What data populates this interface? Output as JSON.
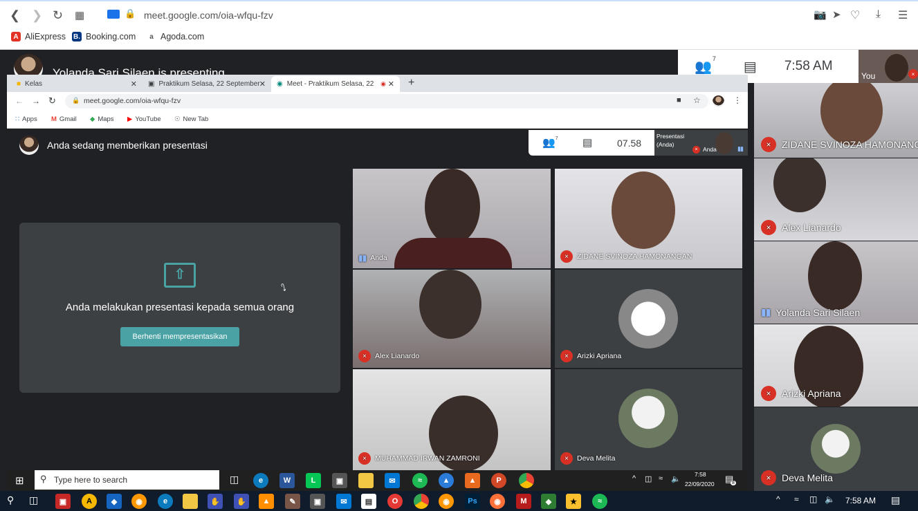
{
  "outer_browser": {
    "url": "meet.google.com/oia-wfqu-fzv",
    "bookmarks": [
      "AliExpress",
      "Booking.com",
      "Agoda.com"
    ]
  },
  "meet": {
    "presenting_banner": "Yolanda Sari Silaen is presenting",
    "participants_count": "7",
    "clock": "7:58 AM",
    "self_label": "You"
  },
  "inner_browser": {
    "tabs": [
      "Kelas",
      "Praktikum Selasa, 22 September",
      "Meet - Praktikum Selasa, 22"
    ],
    "url": "meet.google.com/oia-wfqu-fzv",
    "bookmarks": [
      "Apps",
      "Gmail",
      "Maps",
      "YouTube",
      "New Tab"
    ],
    "presenting_text": "Anda sedang memberikan presentasi",
    "participants_count": "7",
    "clock": "07.58",
    "self_tile_text": "Presentasi (Anda)",
    "self_tile_name": "Anda",
    "present_card_text": "Anda melakukan presentasi kepada semua orang",
    "stop_button": "Berhenti mempresentasikan",
    "tiles": [
      "Anda",
      "ZIDANE SVINOZA HAMONANGAN",
      "Alex Lianardo",
      "Arizki Apriana",
      "MUHAMMAD IRWAN ZAMRONI",
      "Deva Melita"
    ],
    "search_placeholder": "Type here to search",
    "tray_time": "7:58",
    "tray_date": "22/09/2020",
    "notif_count": "8"
  },
  "right_tiles": [
    "ZIDANE SVINOZA HAMONANGAN",
    "Alex Lianardo",
    "Yolanda Sari Silaen",
    "Arizki Apriana",
    "Deva Melita"
  ],
  "taskbar": {
    "time": "7:58 AM"
  }
}
